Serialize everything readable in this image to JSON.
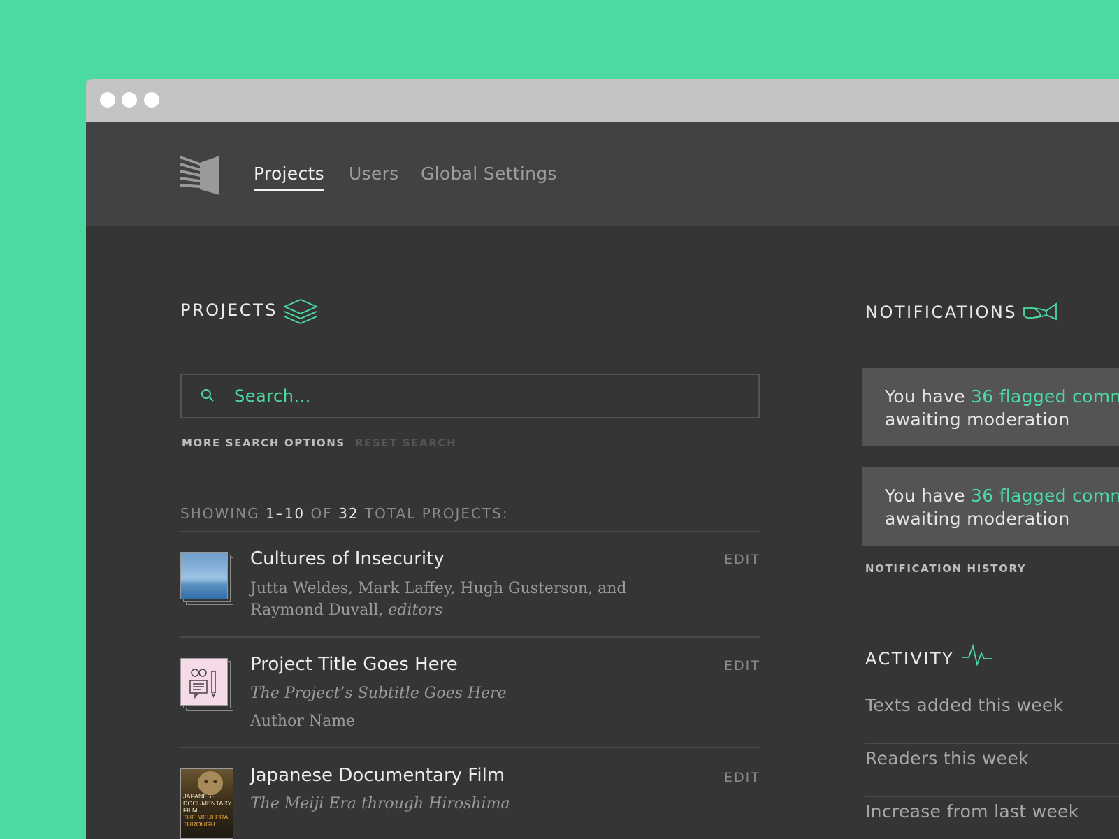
{
  "colors": {
    "accent": "#4cd9a2",
    "background": "#353535",
    "header": "#424244",
    "titlebar": "#c4c4c4"
  },
  "nav": {
    "logo_icon": "manifold-logo-icon",
    "items": [
      {
        "label": "Projects",
        "active": true
      },
      {
        "label": "Users",
        "active": false
      },
      {
        "label": "Global Settings",
        "active": false
      }
    ]
  },
  "projects": {
    "title": "PROJECTS",
    "icon": "layers-icon",
    "search": {
      "placeholder": "Search...",
      "icon": "search-icon"
    },
    "more_search_options": "MORE SEARCH OPTIONS",
    "reset_search": "RESET SEARCH",
    "showing": {
      "prefix": "SHOWING ",
      "range": "1–10",
      "of": " OF ",
      "total": "32",
      "suffix": " TOTAL PROJECTS:"
    },
    "items": [
      {
        "title": "Cultures of Insecurity",
        "authors": "Jutta Weldes, Mark Laffey, Hugh Gusterson, and Raymond Duvall,",
        "authors_role": "editors",
        "edit": "EDIT",
        "thumb": "sea-image"
      },
      {
        "title": "Project Title Goes Here",
        "subtitle": "The Project’s Subtitle Goes Here",
        "author": "Author Name",
        "edit": "EDIT",
        "thumb": "placeholder-glasses-pencil-icon"
      },
      {
        "title": "Japanese Documentary Film",
        "subtitle": "The Meiji Era through Hiroshima",
        "edit": "EDIT",
        "thumb": "poster-image",
        "poster_lines": [
          "JAPANESE",
          "DOCUMENTARY",
          "FILM",
          "THE MEIJI ERA",
          "THROUGH"
        ]
      }
    ]
  },
  "notifications": {
    "title": "NOTIFICATIONS",
    "icon": "horn-icon",
    "items": [
      {
        "prefix": "You have ",
        "highlight": "36 flagged comm",
        "line2": "awaiting moderation"
      },
      {
        "prefix": "You have ",
        "highlight": "36 flagged comm",
        "line2": "awaiting moderation"
      }
    ],
    "history_link": "NOTIFICATION HISTORY"
  },
  "activity": {
    "title": "ACTIVITY",
    "icon": "pulse-icon",
    "items": [
      "Texts added this week",
      "Readers this week",
      "Increase from last week"
    ]
  }
}
